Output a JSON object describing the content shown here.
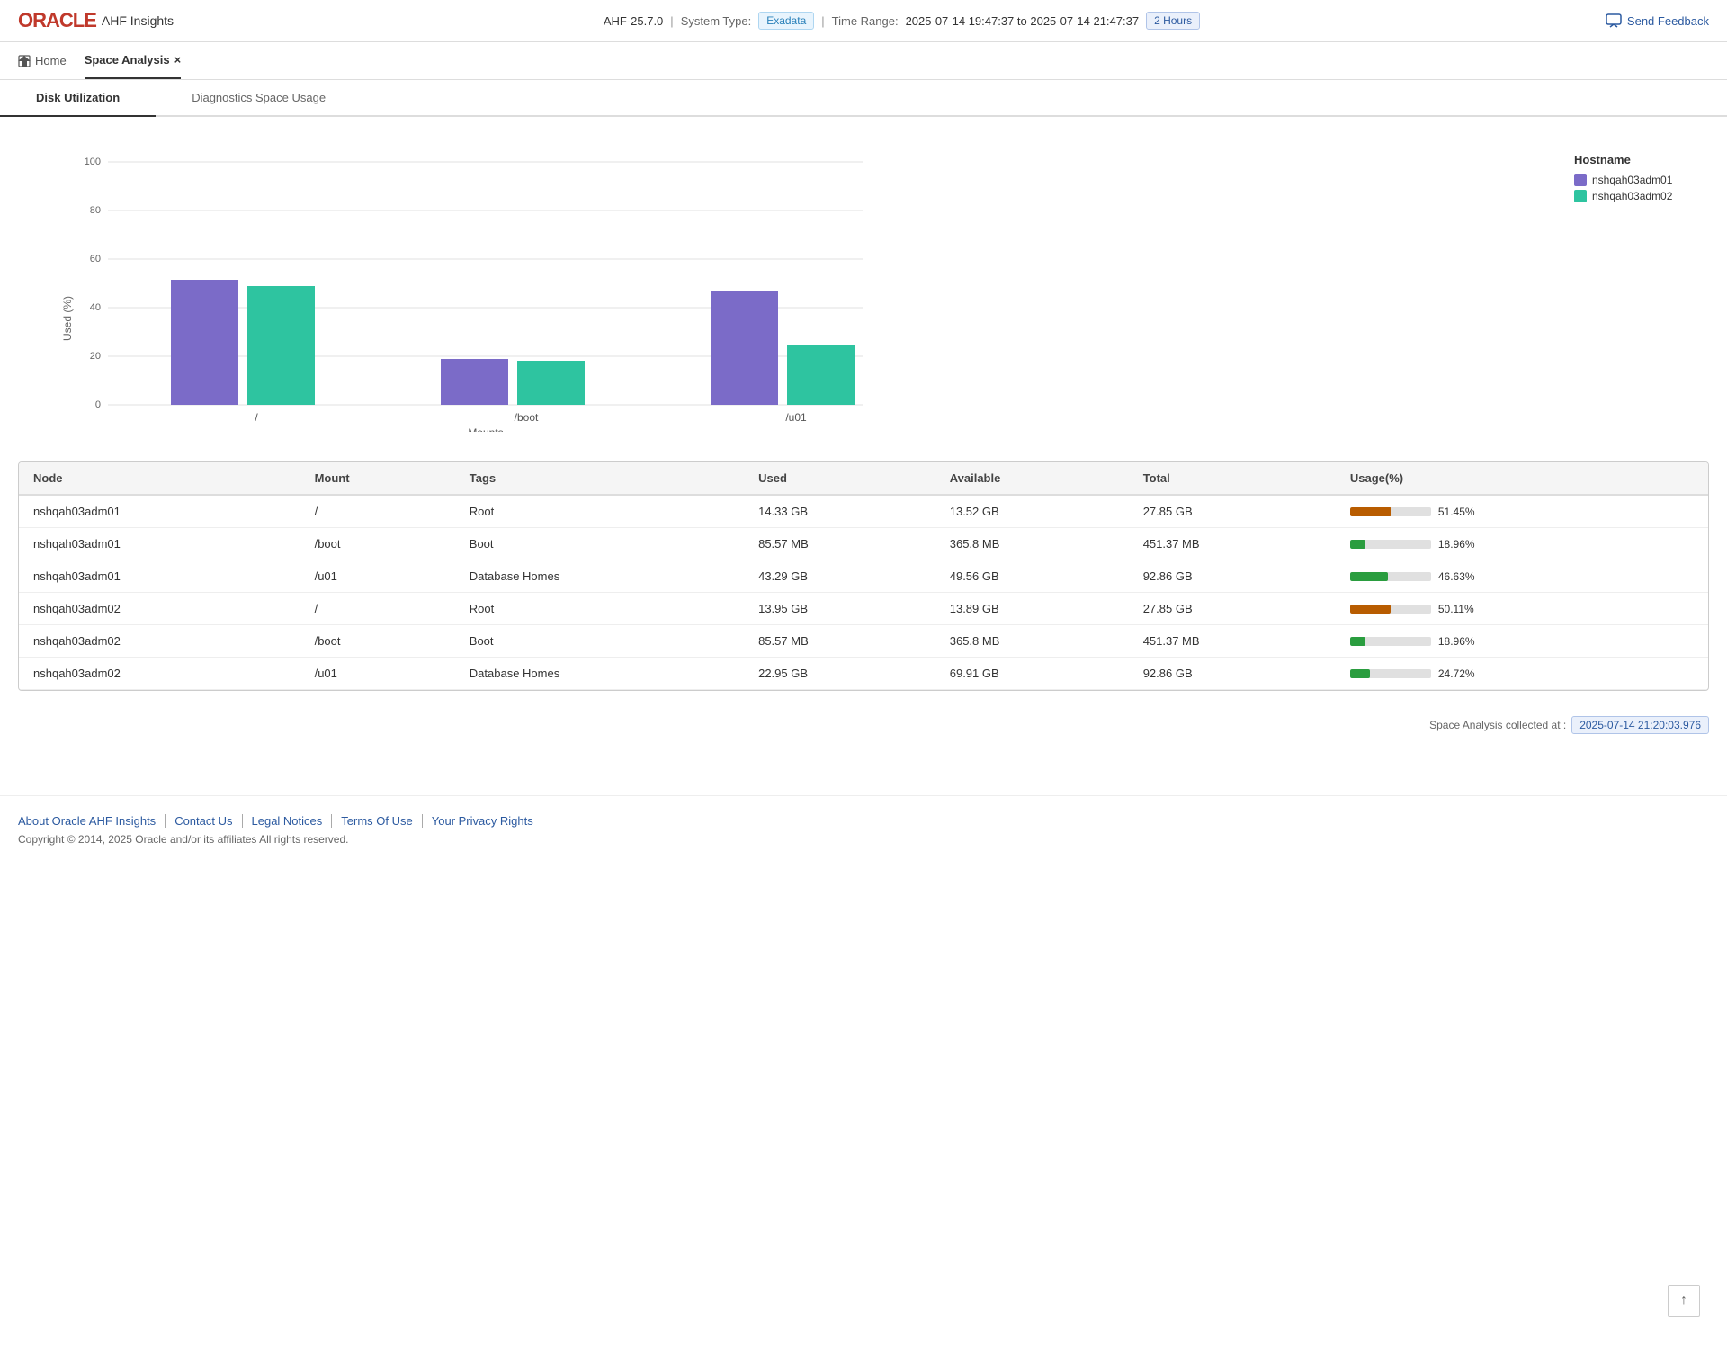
{
  "header": {
    "oracle_logo": "ORACLE",
    "app_name": "AHF Insights",
    "version": "AHF-25.7.0",
    "system_type_label": "System Type:",
    "system_type_value": "Exadata",
    "time_range_label": "Time Range:",
    "time_range_value": "2025-07-14 19:47:37 to 2025-07-14 21:47:37",
    "time_badge": "2 Hours",
    "send_feedback": "Send Feedback"
  },
  "nav": {
    "home_label": "Home",
    "active_tab": "Space Analysis",
    "close_icon": "×"
  },
  "sub_tabs": [
    {
      "id": "disk",
      "label": "Disk Utilization",
      "active": true
    },
    {
      "id": "diag",
      "label": "Diagnostics Space Usage",
      "active": false
    }
  ],
  "chart": {
    "y_label": "Used (%)",
    "x_label": "Mounts",
    "y_ticks": [
      0,
      20,
      40,
      60,
      80,
      100
    ],
    "mounts": [
      "/",
      "/boot",
      "/u01"
    ],
    "legend_title": "Hostname",
    "legend": [
      {
        "label": "nshqah03adm01",
        "color": "#7b6bc8"
      },
      {
        "label": "nshqah03adm02",
        "color": "#2ec4a0"
      }
    ],
    "bars": {
      "/": {
        "adm01": 51.45,
        "adm02": 49
      },
      "/boot": {
        "adm01": 18.96,
        "adm02": 18
      },
      "/u01": {
        "adm01": 46.63,
        "adm02": 24.72
      }
    }
  },
  "table": {
    "columns": [
      "Node",
      "Mount",
      "Tags",
      "Used",
      "Available",
      "Total",
      "Usage(%)"
    ],
    "rows": [
      {
        "node": "nshqah03adm01",
        "mount": "/",
        "tags": "Root",
        "used": "14.33 GB",
        "available": "13.52 GB",
        "total": "27.85 GB",
        "pct": 51.45,
        "pct_label": "51.45%"
      },
      {
        "node": "nshqah03adm01",
        "mount": "/boot",
        "tags": "Boot",
        "used": "85.57 MB",
        "available": "365.8 MB",
        "total": "451.37 MB",
        "pct": 18.96,
        "pct_label": "18.96%"
      },
      {
        "node": "nshqah03adm01",
        "mount": "/u01",
        "tags": "Database Homes",
        "used": "43.29 GB",
        "available": "49.56 GB",
        "total": "92.86 GB",
        "pct": 46.63,
        "pct_label": "46.63%"
      },
      {
        "node": "nshqah03adm02",
        "mount": "/",
        "tags": "Root",
        "used": "13.95 GB",
        "available": "13.89 GB",
        "total": "27.85 GB",
        "pct": 50.11,
        "pct_label": "50.11%"
      },
      {
        "node": "nshqah03adm02",
        "mount": "/boot",
        "tags": "Boot",
        "used": "85.57 MB",
        "available": "365.8 MB",
        "total": "451.37 MB",
        "pct": 18.96,
        "pct_label": "18.96%"
      },
      {
        "node": "nshqah03adm02",
        "mount": "/u01",
        "tags": "Database Homes",
        "used": "22.95 GB",
        "available": "69.91 GB",
        "total": "92.86 GB",
        "pct": 24.72,
        "pct_label": "24.72%"
      }
    ]
  },
  "collected": {
    "label": "Space Analysis collected at :",
    "value": "2025-07-14 21:20:03.976"
  },
  "footer": {
    "links": [
      "About Oracle AHF Insights",
      "Contact Us",
      "Legal Notices",
      "Terms Of Use",
      "Your Privacy Rights"
    ],
    "copyright": "Copyright © 2014, 2025 Oracle and/or its affiliates All rights reserved."
  },
  "colors": {
    "adm01": "#7b6bc8",
    "adm02": "#2ec4a0",
    "high_usage": "#b85c00",
    "mid_usage": "#2a9d3f",
    "low_usage": "#2a9d3f"
  }
}
